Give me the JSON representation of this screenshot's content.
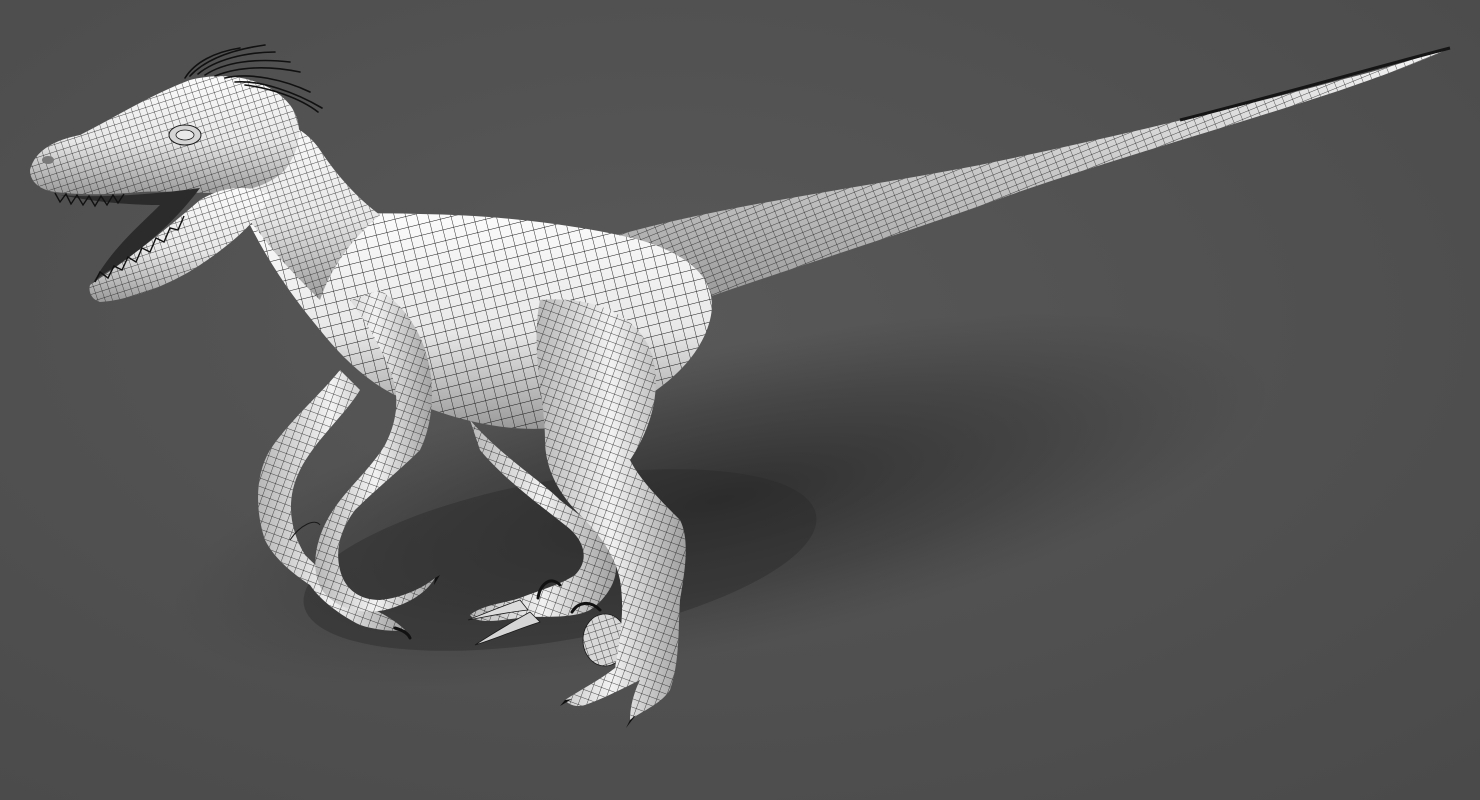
{
  "scene": {
    "subject": "wireframe-raptor",
    "colors": {
      "background": "#4e4e4e",
      "background_light": "#575757",
      "shadow": "#2c2c2c",
      "body_light": "#f7f7f7",
      "body_mid": "#cfcfcf",
      "body_dark": "#8a8a8a",
      "wire": "#1a1a1a",
      "crest": "#111111"
    },
    "icons": [
      "raptor-model",
      "wireframe-mesh"
    ]
  }
}
